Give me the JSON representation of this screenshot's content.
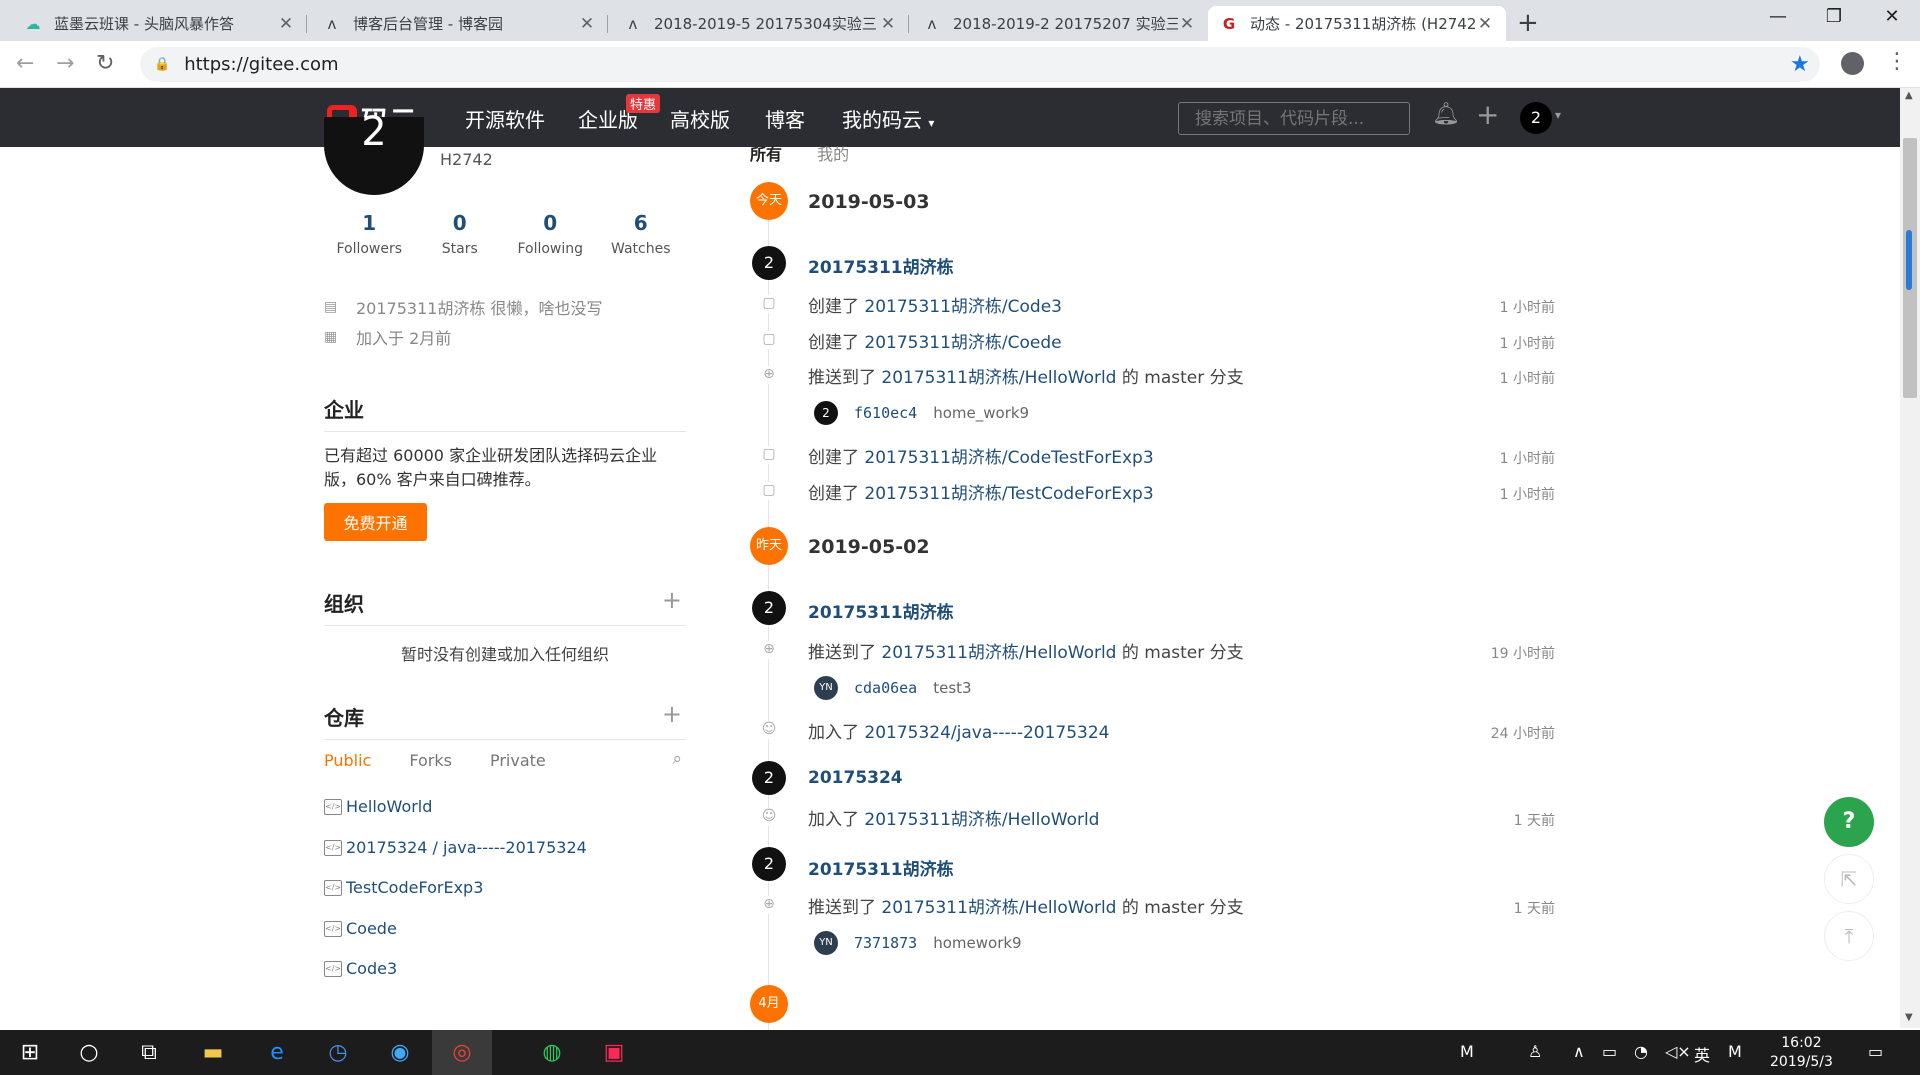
{
  "browser": {
    "tabs": [
      {
        "title": "蓝墨云班课 - 头脑风暴作答",
        "icon": "cloud-icon"
      },
      {
        "title": "博客后台管理 - 博客园",
        "icon": "cnblogs-icon"
      },
      {
        "title": "2018-2019-5 20175304实验三",
        "icon": "cnblogs-icon"
      },
      {
        "title": "2018-2019-2 20175207 实验三",
        "icon": "cnblogs-icon"
      },
      {
        "title": "动态 - 20175311胡济栋 (H2742",
        "icon": "gitee-icon"
      }
    ],
    "url": "https://gitee.com"
  },
  "header": {
    "logo_text": "码云",
    "nav": [
      "开源软件",
      "企业版",
      "高校版",
      "博客",
      "我的码云"
    ],
    "hot_badge": "特惠",
    "search_placeholder": "搜索项目、代码片段...",
    "avatar_letter": "2"
  },
  "profile": {
    "avatar_letter": "2",
    "username": "H2742",
    "stats": [
      {
        "num": "1",
        "label": "Followers"
      },
      {
        "num": "0",
        "label": "Stars"
      },
      {
        "num": "0",
        "label": "Following"
      },
      {
        "num": "6",
        "label": "Watches"
      }
    ],
    "bio": "20175311胡济栋 很懒，啥也没写",
    "joined": "加入于 2月前"
  },
  "enterprise": {
    "title": "企业",
    "desc": "已有超过 60000 家企业研发团队选择码云企业版，60% 客户来自口碑推荐。",
    "button": "免费开通"
  },
  "orgs": {
    "title": "组织",
    "empty": "暂时没有创建或加入任何组织"
  },
  "repos": {
    "title": "仓库",
    "tabs": [
      "Public",
      "Forks",
      "Private"
    ],
    "items": [
      "HelloWorld",
      "20175324 / java-----20175324",
      "TestCodeForExp3",
      "Coede",
      "Code3"
    ]
  },
  "feed": {
    "filters": [
      "所有",
      "我的"
    ],
    "groups": [
      {
        "badge": "今天",
        "date": "2019-05-03"
      },
      {
        "badge": "昨天",
        "date": "2019-05-02"
      },
      {
        "badge": "4月",
        "date": ""
      }
    ],
    "users": [
      {
        "letter": "2",
        "name": "20175311胡济栋"
      },
      {
        "letter": "2",
        "name": "20175311胡济栋"
      },
      {
        "letter": "2",
        "name": "20175324"
      },
      {
        "letter": "2",
        "name": "20175311胡济栋"
      }
    ],
    "events": [
      {
        "prefix": "创建了",
        "link": "20175311胡济栋/Code3",
        "suffix": "",
        "time": "1 小时前"
      },
      {
        "prefix": "创建了",
        "link": "20175311胡济栋/Coede",
        "suffix": "",
        "time": "1 小时前"
      },
      {
        "prefix": "推送到了",
        "link": "20175311胡济栋/HelloWorld",
        "suffix": " 的 master 分支",
        "time": "1 小时前"
      },
      {
        "prefix": "创建了",
        "link": "20175311胡济栋/CodeTestForExp3",
        "suffix": "",
        "time": "1 小时前"
      },
      {
        "prefix": "创建了",
        "link": "20175311胡济栋/TestCodeForExp3",
        "suffix": "",
        "time": "1 小时前"
      },
      {
        "prefix": "推送到了",
        "link": "20175311胡济栋/HelloWorld",
        "suffix": " 的 master 分支",
        "time": "19 小时前"
      },
      {
        "prefix": "加入了",
        "link": "20175324/java-----20175324",
        "suffix": "",
        "time": "24 小时前"
      },
      {
        "prefix": "加入了",
        "link": "20175311胡济栋/HelloWorld",
        "suffix": "",
        "time": "1 天前"
      },
      {
        "prefix": "推送到了",
        "link": "20175311胡济栋/HelloWorld",
        "suffix": " 的 master 分支",
        "time": "1 天前"
      }
    ],
    "commits": [
      {
        "avatar": "2",
        "sha": "f610ec4",
        "msg": "home_work9"
      },
      {
        "avatar": "YN",
        "sha": "cda06ea",
        "msg": "test3"
      },
      {
        "avatar": "YN",
        "sha": "7371873",
        "msg": "homework9"
      }
    ]
  },
  "floating": {
    "help": "?"
  },
  "taskbar": {
    "time": "16:02",
    "date": "2019/5/3",
    "ime": "英"
  }
}
